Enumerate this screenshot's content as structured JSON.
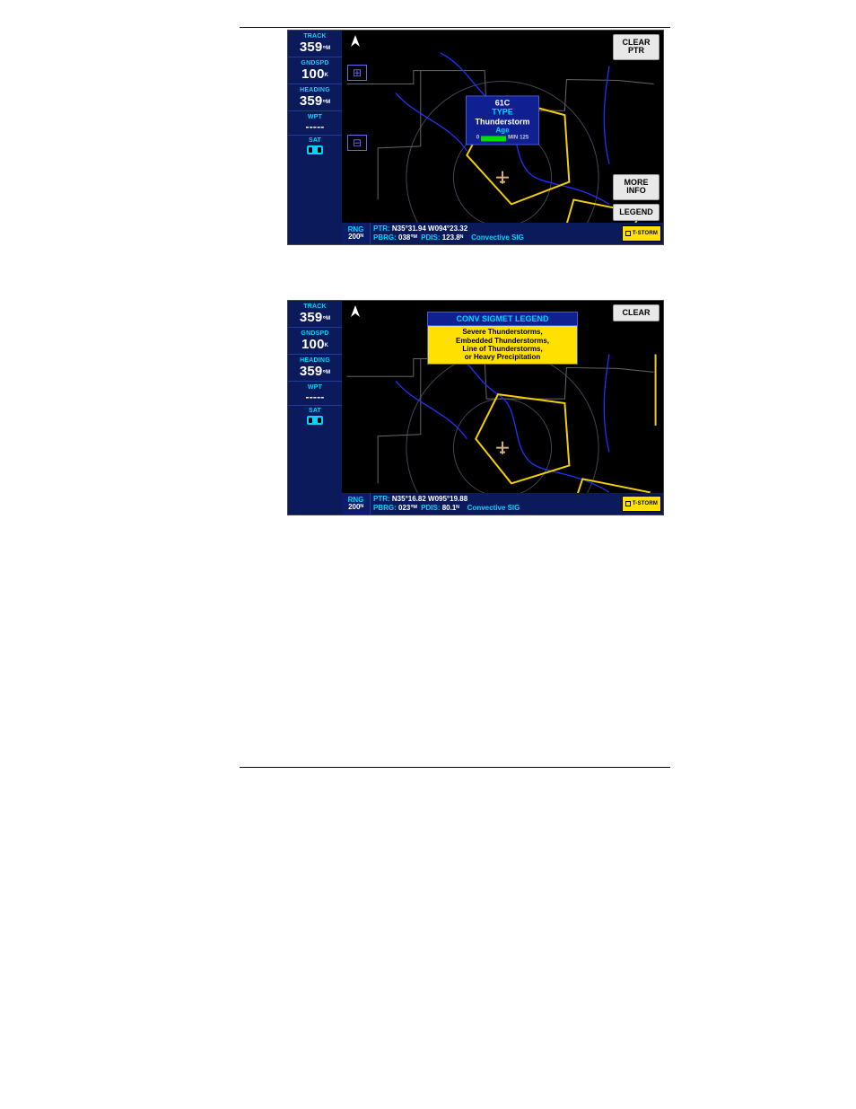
{
  "shot1": {
    "sidebar": {
      "track_label": "TRACK",
      "track_value": "359",
      "track_unit": "°ᴹ",
      "gndspd_label": "GNDSPD",
      "gndspd_value": "100",
      "gndspd_unit": "ᴷ",
      "heading_label": "HEADING",
      "heading_value": "359",
      "heading_unit": "°ᴹ",
      "wpt_label": "WPT",
      "wpt_value": "-----",
      "sat_label": "SAT"
    },
    "buttons": {
      "clear_ptr": "CLEAR PTR",
      "more_info": "MORE INFO",
      "legend": "LEGEND"
    },
    "popup": {
      "id": "61C",
      "type_label": "TYPE",
      "type_value": "Thunderstorm",
      "age_label": "Age",
      "age_min": "0",
      "age_unit": "MIN",
      "age_max": "125"
    },
    "bottombar": {
      "rng_label": "RNG",
      "rng_value": "200ᴺ",
      "ptr_label": "PTR:",
      "ptr_value": "N35°31.94 W094°23.32",
      "pbrg_label": "PBRG:",
      "pbrg_value": "038°ᴹ",
      "pdis_label": "PDIS:",
      "pdis_value": "123.8ᴺ",
      "mode": "Convective SIG",
      "tstorm": "T-STORM"
    }
  },
  "shot2": {
    "sidebar": {
      "track_label": "TRACK",
      "track_value": "359",
      "track_unit": "°ᴹ",
      "gndspd_label": "GNDSPD",
      "gndspd_value": "100",
      "gndspd_unit": "ᴷ",
      "heading_label": "HEADING",
      "heading_value": "359",
      "heading_unit": "°ᴹ",
      "wpt_label": "WPT",
      "wpt_value": "-----",
      "sat_label": "SAT"
    },
    "buttons": {
      "clear": "CLEAR"
    },
    "legend_popup": {
      "title": "CONV SIGMET LEGEND",
      "line1": "Severe Thunderstorms,",
      "line2": "Embedded Thunderstorms,",
      "line3": "Line of Thunderstorms,",
      "line4": "or Heavy Precipitation"
    },
    "bottombar": {
      "rng_label": "RNG",
      "rng_value": "200ᴺ",
      "ptr_label": "PTR:",
      "ptr_value": "N35°16.82 W095°19.88",
      "pbrg_label": "PBRG:",
      "pbrg_value": "023°ᴹ",
      "pdis_label": "PDIS:",
      "pdis_value": "80.1ᴺ",
      "mode": "Convective SIG",
      "tstorm": "T-STORM"
    }
  }
}
